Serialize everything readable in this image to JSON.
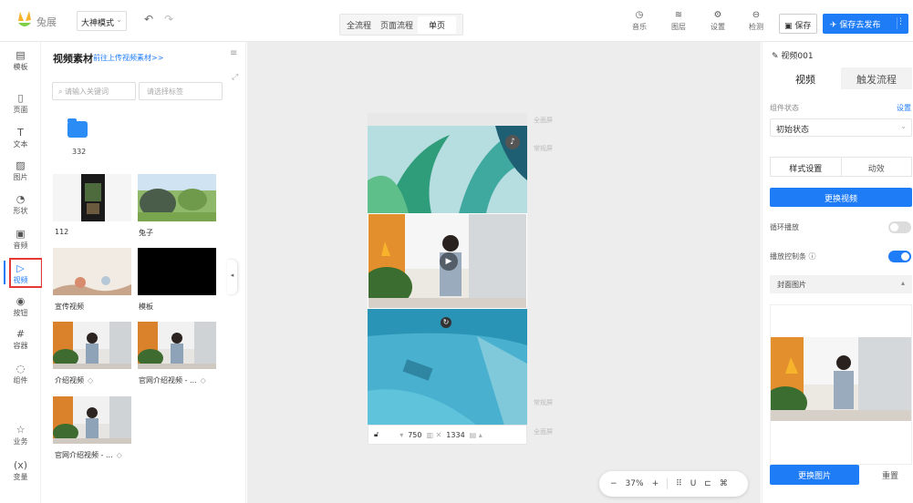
{
  "app": {
    "logo_text": "兔展"
  },
  "toolbar": {
    "mode": "大神模式",
    "flow_tabs": [
      "全流程",
      "页面流程",
      "单页"
    ],
    "tools": [
      {
        "icon": "music-icon",
        "label": "音乐"
      },
      {
        "icon": "layers-icon",
        "label": "图层"
      },
      {
        "icon": "settings-icon",
        "label": "设置"
      },
      {
        "icon": "check-icon",
        "label": "检测"
      }
    ],
    "save_label": "保存",
    "publish_label": "保存去发布"
  },
  "rail": [
    {
      "key": "template",
      "label": "模板",
      "icon": "▤"
    },
    {
      "key": "page",
      "label": "页面",
      "icon": "▯"
    },
    {
      "key": "text",
      "label": "文本",
      "icon": "T"
    },
    {
      "key": "image",
      "label": "图片",
      "icon": "▨"
    },
    {
      "key": "shape",
      "label": "形状",
      "icon": "◔"
    },
    {
      "key": "audio",
      "label": "音频",
      "icon": "▣"
    },
    {
      "key": "video",
      "label": "视频",
      "icon": "▷"
    },
    {
      "key": "button",
      "label": "按钮",
      "icon": "◉"
    },
    {
      "key": "container",
      "label": "容器",
      "icon": "#"
    },
    {
      "key": "component",
      "label": "组件",
      "icon": "◌"
    },
    {
      "key": "business",
      "label": "业务",
      "icon": "☆"
    },
    {
      "key": "variable",
      "label": "变量",
      "icon": "(x)"
    }
  ],
  "assets": {
    "title": "视频素材",
    "upload_link": "前往上传视频素材>>",
    "search_placeholder": "请输入关键词",
    "tag_placeholder": "请选择标签",
    "folder": {
      "name": "332"
    },
    "items": [
      {
        "name": "112",
        "tag": false
      },
      {
        "name": "兔子",
        "tag": false
      },
      {
        "name": "宣传视频",
        "tag": false
      },
      {
        "name": "模板",
        "tag": false
      },
      {
        "name": "介绍视频",
        "tag": true
      },
      {
        "name": "官网介绍视频 - ...",
        "tag": true
      },
      {
        "name": "官网介绍视频 - ...",
        "tag": true
      }
    ],
    "tag_icon": "◇"
  },
  "canvas": {
    "note_full": "全面屏",
    "note_normal": "常规屏",
    "width": "750",
    "height": "1334",
    "zoom": "37%"
  },
  "props": {
    "title": "视频001",
    "tabs": [
      "视频",
      "触发流程"
    ],
    "state_label": "组件状态",
    "state_link": "设置",
    "state_value": "初始状态",
    "sub_tabs": [
      "样式设置",
      "动效"
    ],
    "replace_video": "更换视频",
    "loop_label": "循环播放",
    "loop_on": false,
    "controls_label": "播放控制条 ⓘ",
    "controls_on": true,
    "cover_label": "封面图片",
    "replace_image": "更换图片",
    "reset_label": "重置",
    "accent": "#1f7cf7"
  }
}
